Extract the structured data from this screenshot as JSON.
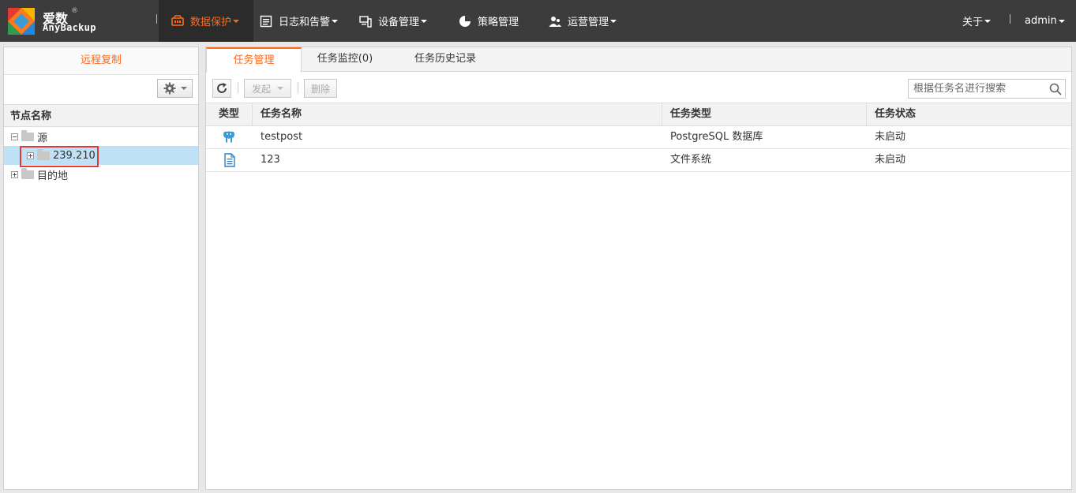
{
  "brand": {
    "name_cn": "爱数",
    "reg": "®",
    "name_en": "AnyBackup"
  },
  "nav": {
    "items": [
      {
        "label": "数据保护",
        "icon": "data-protection-icon",
        "active": true
      },
      {
        "label": "日志和告警",
        "icon": "log-icon",
        "active": false
      },
      {
        "label": "设备管理",
        "icon": "device-icon",
        "active": false
      },
      {
        "label": "策略管理",
        "icon": "pie-chart-icon",
        "active": false
      },
      {
        "label": "运营管理",
        "icon": "users-icon",
        "active": false
      }
    ],
    "about": "关于",
    "user": "admin"
  },
  "left": {
    "title": "远程复制",
    "column_header": "节点名称",
    "tree": [
      {
        "label": "源",
        "level": 0,
        "expanded": true
      },
      {
        "label": "239.210",
        "level": 1,
        "expanded": false,
        "selected": true
      },
      {
        "label": "目的地",
        "level": 0,
        "expanded": false
      }
    ]
  },
  "tabs": [
    {
      "label": "任务管理",
      "active": true
    },
    {
      "label": "任务监控(0)",
      "active": false
    },
    {
      "label": "任务历史记录",
      "active": false
    }
  ],
  "toolbar": {
    "start_label": "发起",
    "delete_label": "删除",
    "search_placeholder": "根据任务名进行搜索"
  },
  "table": {
    "columns": [
      "类型",
      "任务名称",
      "任务类型",
      "任务状态"
    ],
    "rows": [
      {
        "type_icon": "postgresql-icon",
        "name": "testpost",
        "task_type": "PostgreSQL 数据库",
        "status": "未启动"
      },
      {
        "type_icon": "file-system-icon",
        "name": "123",
        "task_type": "文件系统",
        "status": "未启动"
      }
    ]
  },
  "colors": {
    "accent": "#ff6a1a",
    "topbar": "#3c3c3c",
    "selected_row": "#bee1f5",
    "highlight": "#e53935"
  }
}
